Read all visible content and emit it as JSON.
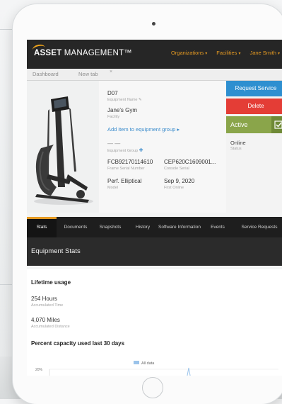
{
  "app": {
    "logo_prefix": "ASSET",
    "logo_suffix": "MANAGEMENT™",
    "brand_color": "#e59a22"
  },
  "topnav": {
    "links": [
      {
        "label": "Organizations"
      },
      {
        "label": "Facilities"
      },
      {
        "label": "Jane Smith"
      }
    ]
  },
  "tabs": [
    {
      "label": "Dashboard"
    },
    {
      "label": "New tab"
    }
  ],
  "equipment": {
    "name": "D07",
    "name_label": "Equipment Name",
    "facility": "Jane's Gym",
    "facility_label": "Facility",
    "add_group_link": "Add item to equipment group ▸",
    "group_value": "— —",
    "group_label": "Equipment Group",
    "frame_serial": "FCB92170114610",
    "frame_serial_label": "Frame Serial Number",
    "console_serial": "CEP620C1609001...",
    "console_serial_label": "Console Serial",
    "model": "Perf. Elliptical",
    "model_label": "Model",
    "first_online": "Sep 9, 2020",
    "first_online_label": "First Online"
  },
  "actions": {
    "request_service": "Request Service",
    "delete": "Delete",
    "active": "Active",
    "status_value": "Online",
    "status_label": "Status"
  },
  "section_tabs": [
    {
      "label": "Stats",
      "active": true
    },
    {
      "label": "Documents"
    },
    {
      "label": "Snapshots"
    },
    {
      "label": "History"
    },
    {
      "label": "Software Information"
    },
    {
      "label": "Events"
    },
    {
      "label": "Service Requests"
    }
  ],
  "stats": {
    "header": "Equipment Stats",
    "lifetime_title": "Lifetime usage",
    "hours_value": "254 Hours",
    "hours_label": "Accumulated Time",
    "miles_value": "4,070 Miles",
    "miles_label": "Accumulated Distance",
    "capacity_title": "Percent capacity used last 30 days"
  },
  "chart_data": {
    "type": "line",
    "legend": [
      "All data"
    ],
    "y_tick_top": "20%",
    "series": [
      {
        "name": "All data",
        "color": "#9bc3ea"
      }
    ]
  }
}
